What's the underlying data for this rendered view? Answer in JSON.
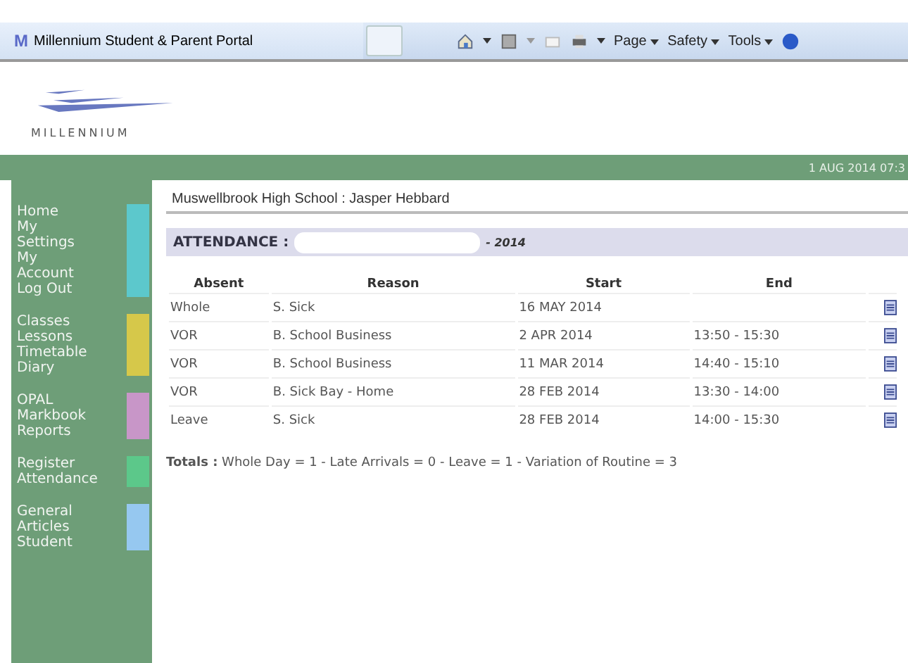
{
  "browser": {
    "tab_title": "Millennium Student & Parent Portal",
    "tab_logo": "M",
    "menus": [
      "Page",
      "Safety",
      "Tools"
    ]
  },
  "header": {
    "logo_text": "MILLENNIUM",
    "datetime": "1 AUG 2014 07:3"
  },
  "sidebar": {
    "groups": [
      {
        "color": "#5cc8cc",
        "items": [
          "Home",
          "My",
          "Settings",
          "My",
          "Account",
          "Log Out"
        ]
      },
      {
        "color": "#d6c84a",
        "items": [
          "Classes",
          "Lessons",
          "Timetable",
          "Diary"
        ]
      },
      {
        "color": "#c896c8",
        "items": [
          "OPAL",
          "Markbook",
          "Reports"
        ]
      },
      {
        "color": "#5cc88a",
        "items": [
          "Register",
          "Attendance"
        ]
      },
      {
        "color": "#96c8f0",
        "items": [
          "General",
          "Articles",
          "Student"
        ]
      }
    ]
  },
  "page": {
    "school_student": "Muswellbrook High School : Jasper Hebbard",
    "section_label": "ATTENDANCE :",
    "year": "- 2014",
    "table": {
      "columns": [
        "Absent",
        "Reason",
        "Start",
        "End"
      ],
      "rows": [
        {
          "absent": "Whole",
          "reason": "S. Sick",
          "start": "16 MAY 2014",
          "end": ""
        },
        {
          "absent": "VOR",
          "reason": "B. School Business",
          "start": "2 APR 2014",
          "end": "13:50 - 15:30"
        },
        {
          "absent": "VOR",
          "reason": "B. School Business",
          "start": "11 MAR 2014",
          "end": "14:40 - 15:10"
        },
        {
          "absent": "VOR",
          "reason": "B. Sick Bay - Home",
          "start": "28 FEB 2014",
          "end": "13:30 - 14:00"
        },
        {
          "absent": "Leave",
          "reason": "S. Sick",
          "start": "28 FEB 2014",
          "end": "14:00 - 15:30"
        }
      ]
    },
    "totals": "**Totals :** Whole Day = 1 - Late Arrivals = 0 - Leave = 1 - Variation of Routine = 3"
  }
}
